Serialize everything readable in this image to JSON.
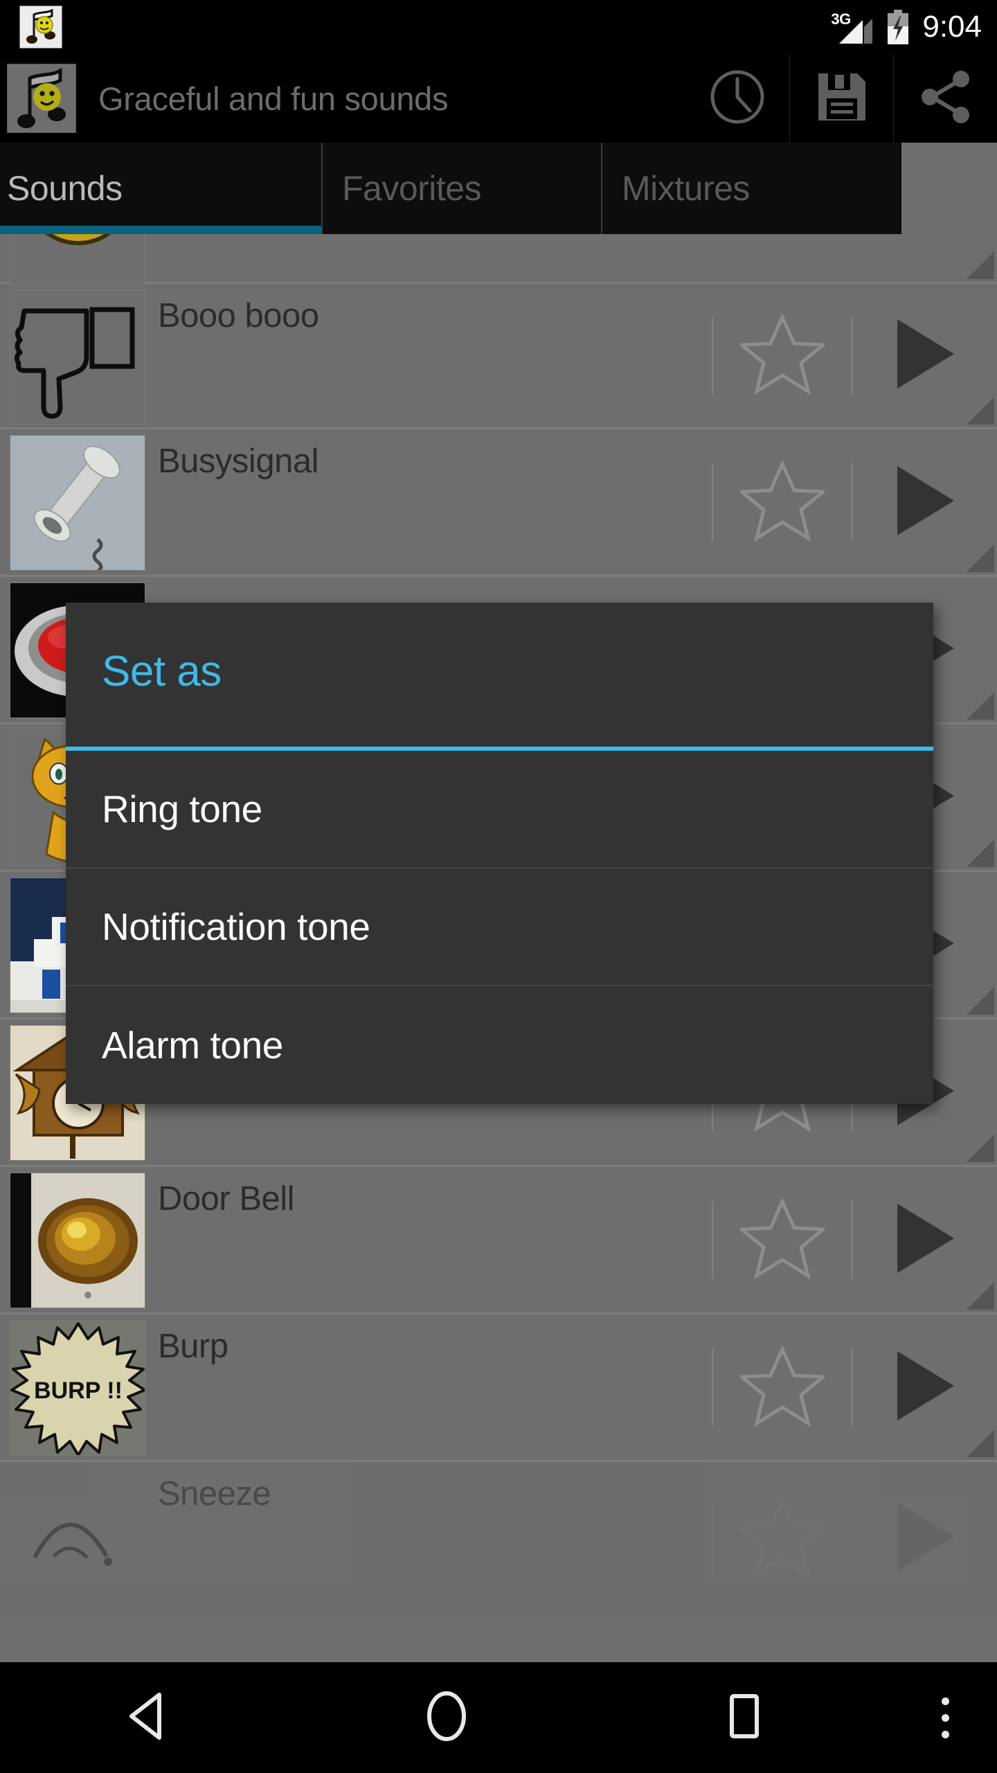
{
  "status_bar": {
    "network_label": "3G",
    "network_icon": "signal-bars-icon",
    "battery_icon": "battery-charging-icon",
    "time": "9:04",
    "app_badge_icon": "music-note-smiley-icon"
  },
  "action_bar": {
    "app_icon": "music-note-smiley-icon",
    "title": "Graceful and fun sounds",
    "actions": [
      {
        "name": "timer-button",
        "icon": "clock-icon"
      },
      {
        "name": "save-button",
        "icon": "floppy-disk-icon"
      },
      {
        "name": "share-button",
        "icon": "share-icon"
      }
    ]
  },
  "tabs": {
    "active_index": 0,
    "active_underline_color": "#0a637c",
    "items": [
      {
        "label": "Sounds"
      },
      {
        "label": "Favorites"
      },
      {
        "label": "Mixtures"
      }
    ]
  },
  "sound_list": {
    "favorite_icon": "star-outline-icon",
    "play_icon": "play-triangle-icon",
    "overflow_marker_icon": "corner-triangle-icon",
    "rows": [
      {
        "label": "",
        "thumb": "smiley-face-thumb",
        "partial": true
      },
      {
        "label": "Booo booo",
        "thumb": "thumbs-down-thumb"
      },
      {
        "label": "Busysignal",
        "thumb": "telephone-handset-thumb"
      },
      {
        "label": "",
        "thumb": "red-button-thumb"
      },
      {
        "label": "",
        "thumb": "orange-cat-thumb"
      },
      {
        "label": "",
        "thumb": "blue-white-building-thumb"
      },
      {
        "label": "",
        "thumb": "cuckoo-clock-thumb"
      },
      {
        "label": "Door Bell",
        "thumb": "door-bell-thumb"
      },
      {
        "label": "Burp",
        "thumb": "burp-starburst-thumb",
        "thumb_text": "BURP !!"
      },
      {
        "label": "Sneeze",
        "thumb": "sneeze-thumb",
        "partial": true
      }
    ]
  },
  "dialog": {
    "title": "Set as",
    "title_color": "#3fb9e8",
    "accent_color": "#3fb9e8",
    "background_color": "#333333",
    "options": [
      {
        "label": "Ring tone"
      },
      {
        "label": "Notification tone"
      },
      {
        "label": "Alarm tone"
      }
    ]
  },
  "nav_bar": {
    "buttons": [
      {
        "name": "back-button",
        "icon": "back-triangle-icon"
      },
      {
        "name": "home-button",
        "icon": "home-circle-icon"
      },
      {
        "name": "recents-button",
        "icon": "recents-square-icon"
      },
      {
        "name": "overflow-button",
        "icon": "three-dots-icon"
      }
    ]
  }
}
